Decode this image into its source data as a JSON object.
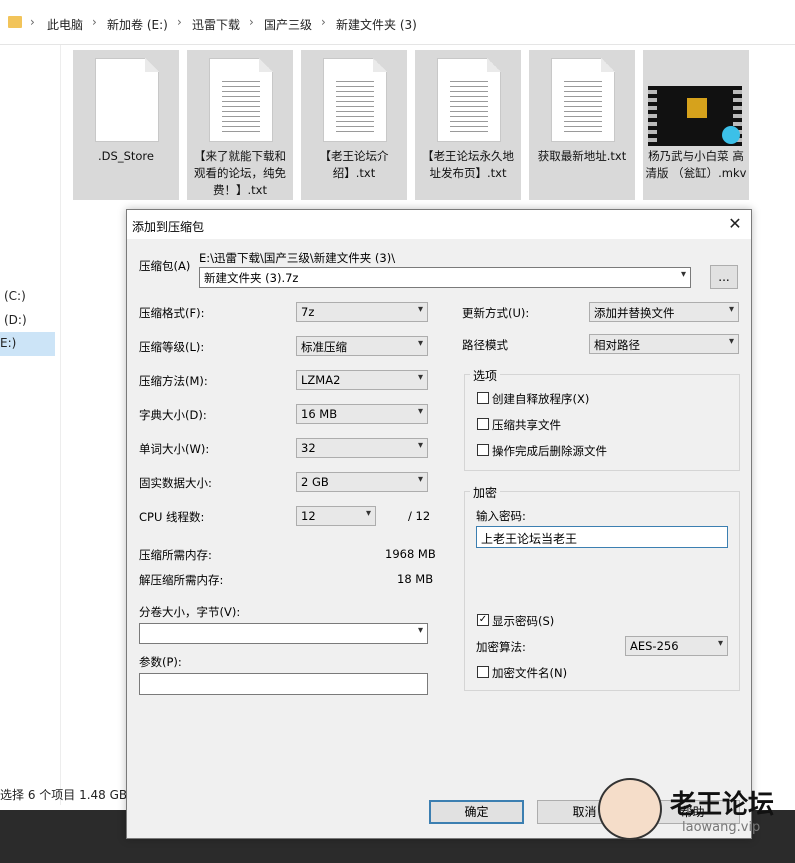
{
  "breadcrumb": [
    "此电脑",
    "新加卷 (E:)",
    "迅雷下载",
    "国产三级",
    "新建文件夹 (3)"
  ],
  "drives": [
    "(C:)",
    "(D:)",
    "E:)"
  ],
  "files": [
    {
      "name": ".DS_Store"
    },
    {
      "name": "【来了就能下载和观看的论坛，纯免费！】.txt"
    },
    {
      "name": "【老王论坛介绍】.txt"
    },
    {
      "name": "【老王论坛永久地址发布页】.txt"
    },
    {
      "name": "获取最新地址.txt"
    },
    {
      "name": "杨乃武与小白菜 高清版 （瓮缸）.mkv"
    }
  ],
  "status": "选择 6 个项目  1.48 GB",
  "dialog": {
    "title": "添加到压缩包",
    "close_glyph": "✕",
    "archive_label": "压缩包(A)",
    "archive_path": "E:\\迅雷下载\\国产三级\\新建文件夹 (3)\\",
    "archive_name": "新建文件夹 (3).7z",
    "browse_label": "...",
    "format_label": "压缩格式(F):",
    "format_value": "7z",
    "level_label": "压缩等级(L):",
    "level_value": "标准压缩",
    "method_label": "压缩方法(M):",
    "method_value": "LZMA2",
    "dict_label": "字典大小(D):",
    "dict_value": "16 MB",
    "word_label": "单词大小(W):",
    "word_value": "32",
    "solid_label": "固实数据大小:",
    "solid_value": "2 GB",
    "cpu_label": "CPU 线程数:",
    "cpu_value": "12",
    "cpu_total": "/ 12",
    "mem_compress_label": "压缩所需内存:",
    "mem_compress_value": "1968 MB",
    "mem_decompress_label": "解压缩所需内存:",
    "mem_decompress_value": "18 MB",
    "volume_label": "分卷大小，字节(V):",
    "volume_value": "",
    "params_label": "参数(P):",
    "params_value": "",
    "update_label": "更新方式(U):",
    "update_value": "添加并替换文件",
    "path_label": "路径模式",
    "path_value": "相对路径",
    "options_title": "选项",
    "opt_sfx": "创建自释放程序(X)",
    "opt_shared": "压缩共享文件",
    "opt_delete": "操作完成后删除源文件",
    "encrypt_title": "加密",
    "password_label": "输入密码:",
    "password_value": "上老王论坛当老王",
    "show_password": "显示密码(S)",
    "enc_method_label": "加密算法:",
    "enc_method_value": "AES-256",
    "enc_names": "加密文件名(N)",
    "ok": "确定",
    "cancel": "取消",
    "help": "帮助"
  },
  "watermark": {
    "title": "老王论坛",
    "sub": "laowang.vip"
  },
  "icons": {
    "folder": "folder-icon",
    "dropdown": "▾"
  }
}
